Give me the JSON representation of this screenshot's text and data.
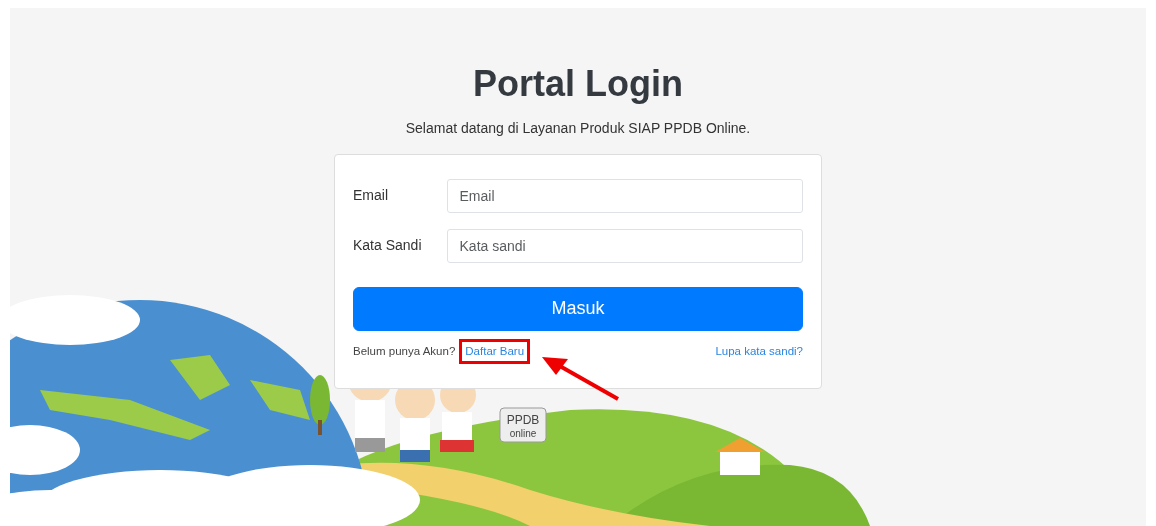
{
  "title": "Portal Login",
  "subtitle": "Selamat datang di Layanan Produk SIAP PPDB Online.",
  "fields": [
    {
      "label": "Email",
      "placeholder": "Email"
    },
    {
      "label": "Kata Sandi",
      "placeholder": "Kata sandi"
    }
  ],
  "submit_button": "Masuk",
  "register": {
    "prompt": "Belum punya Akun?",
    "link": "Daftar Baru",
    "highlighted": true,
    "arrow": true
  },
  "forgot_link": "Lupa kata sandi?",
  "sign": {
    "line1": "PPDB",
    "line2": "online"
  }
}
